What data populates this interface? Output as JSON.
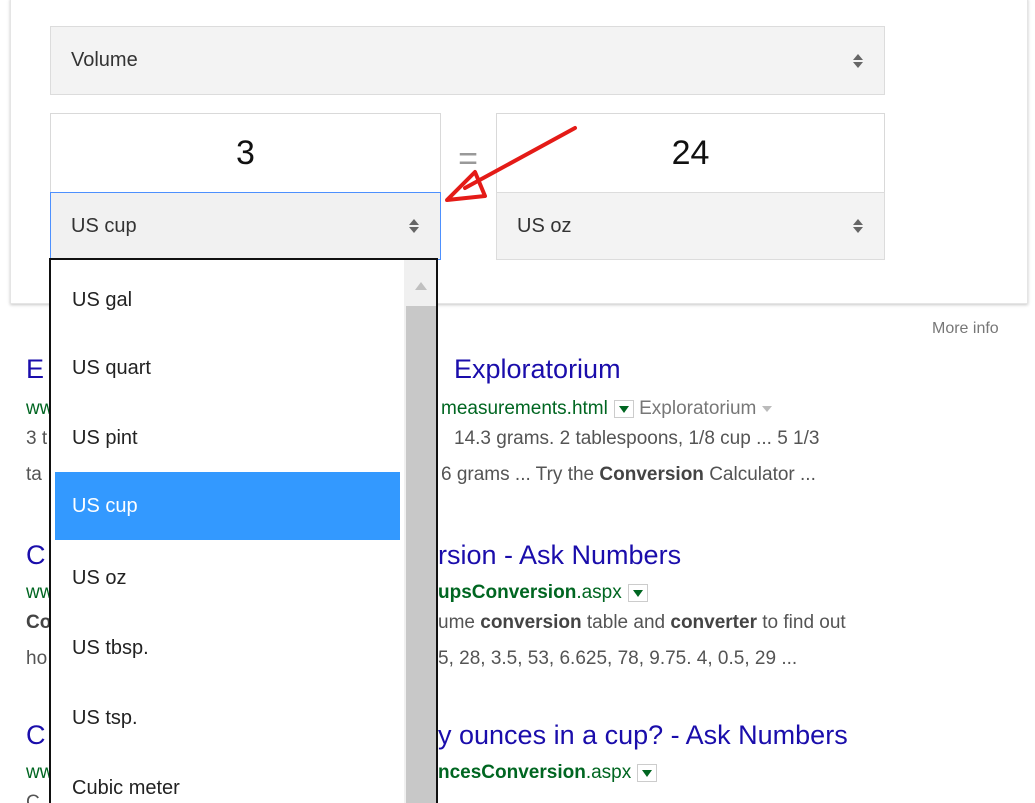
{
  "converter": {
    "quantity": "Volume",
    "from_value": "3",
    "to_value": "24",
    "equals": "=",
    "from_unit": "US cup",
    "to_unit": "US oz"
  },
  "dropdown": {
    "options": [
      "US gal",
      "US quart",
      "US pint",
      "US cup",
      "US oz",
      "US tbsp.",
      "US tsp.",
      "Cubic meter"
    ],
    "selected": "US cup"
  },
  "more_info": "More info",
  "results": [
    {
      "title_a": "E",
      "title_b": "Exploratorium",
      "url_a": "ww",
      "url_b": "measurements.html",
      "source": "Exploratorium",
      "snip1_a": "3 t",
      "snip1_b": "14.3 grams. 2 tablespoons, 1/8 cup ... 5 1/3",
      "snip2_a": "ta",
      "snip2_b": "6 grams ... Try the ",
      "snip2_bold": "Conversion",
      "snip2_c": " Calculator  ..."
    },
    {
      "title_a": "C",
      "title_b": "rsion - Ask Numbers",
      "url_a": "ww",
      "url_b_bold": "upsConversion",
      "url_b": ".aspx",
      "snip1_a_bold": "Co",
      "snip1_b": "ume ",
      "snip1_bold1": "conversion",
      "snip1_c": " table and ",
      "snip1_bold2": "converter",
      "snip1_d": " to find out",
      "snip2_a": "ho",
      "snip2_b": "5, 28, 3.5, 53, 6.625, 78, 9.75. 4, 0.5, 29  ..."
    },
    {
      "title_a": "C",
      "title_b": "y ounces in a cup? - Ask Numbers",
      "url_a": "ww",
      "url_b_bold": "ncesConversion",
      "url_b": ".aspx",
      "snip1_a": "C"
    }
  ],
  "colors": {
    "link": "#1a0dab",
    "url": "#006621",
    "selected_option": "#3399ff",
    "annotation": "#e41b17"
  }
}
